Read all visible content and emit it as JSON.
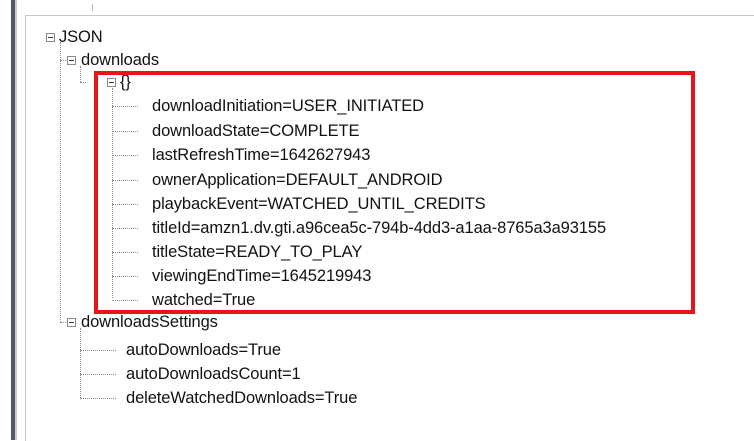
{
  "tree": {
    "root_label": "JSON",
    "downloads": {
      "label": "downloads",
      "object_label": "{}",
      "fields": [
        "downloadInitiation=USER_INITIATED",
        "downloadState=COMPLETE",
        "lastRefreshTime=1642627943",
        "ownerApplication=DEFAULT_ANDROID",
        "playbackEvent=WATCHED_UNTIL_CREDITS",
        "titleId=amzn1.dv.gti.a96cea5c-794b-4dd3-a1aa-8765a3a93155",
        "titleState=READY_TO_PLAY",
        "viewingEndTime=1645219943",
        "watched=True"
      ]
    },
    "downloadsSettings": {
      "label": "downloadsSettings",
      "fields": [
        "autoDownloads=True",
        "autoDownloadsCount=1",
        "deleteWatchedDownloads=True"
      ]
    }
  },
  "colors": {
    "highlight_border": "#e4161b",
    "tree_line": "#8f8f8f"
  }
}
